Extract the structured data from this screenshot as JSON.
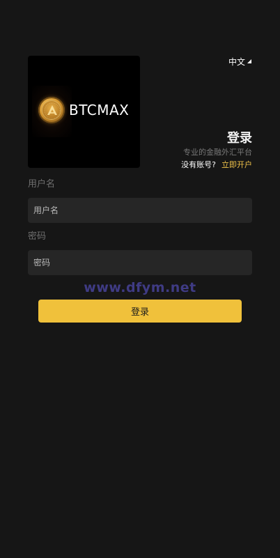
{
  "logo": {
    "brand": "BTCMAX"
  },
  "header": {
    "language": "中文"
  },
  "login": {
    "title": "登录",
    "subtitle": "专业的金融外汇平台",
    "no_account": "没有账号?",
    "register_link": "立即开户"
  },
  "form": {
    "username_label": "用户名",
    "username_placeholder": "用户名",
    "password_label": "密码",
    "password_placeholder": "密码",
    "submit_label": "登录"
  },
  "watermark": "www.dfym.net",
  "colors": {
    "background": "#161616",
    "input_bg": "#262626",
    "accent": "#f0c13b",
    "link": "#f0c34a",
    "watermark": "#3f3b84"
  }
}
